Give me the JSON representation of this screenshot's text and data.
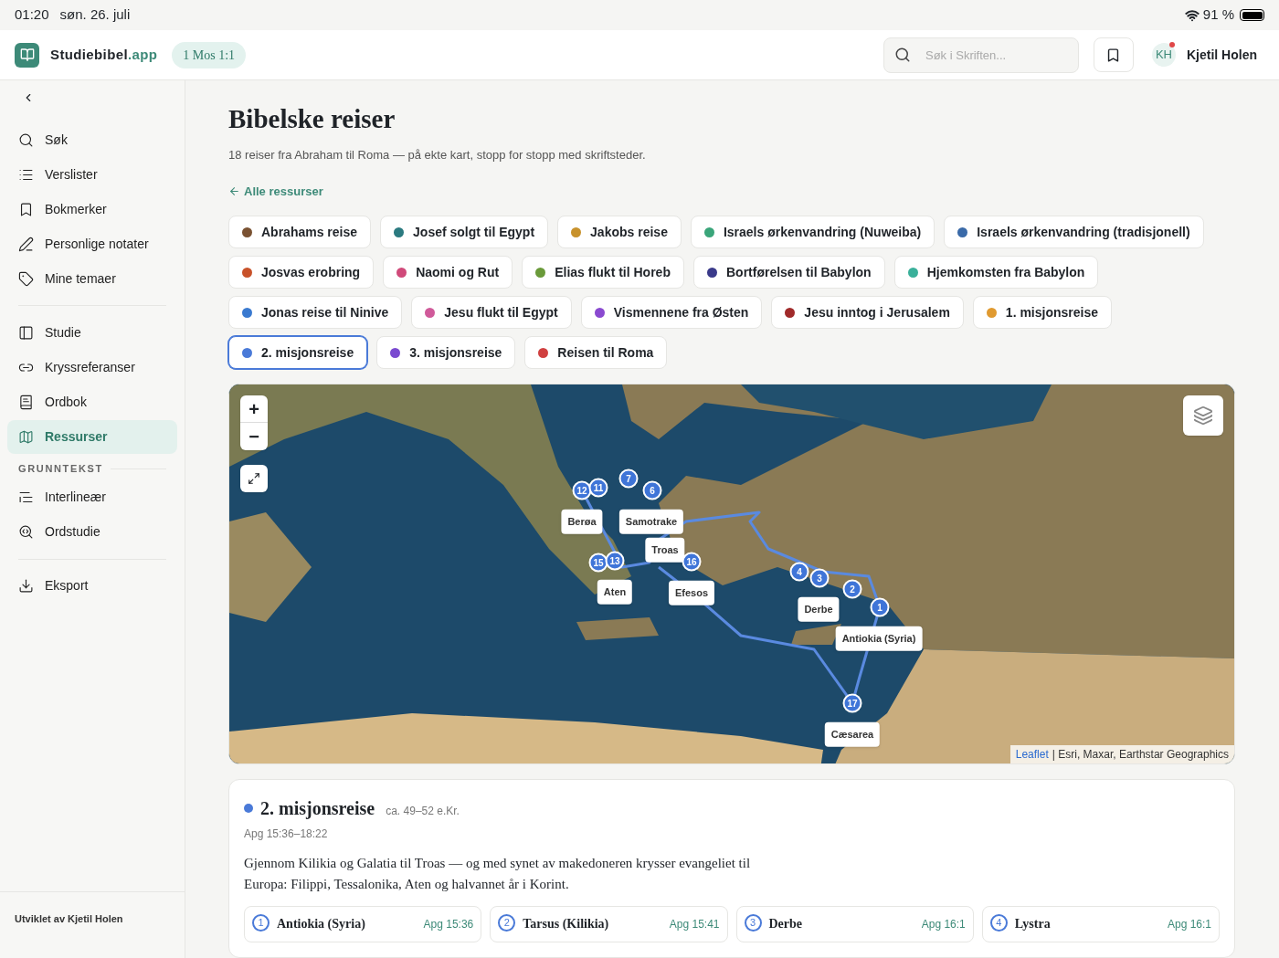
{
  "status_bar": {
    "time": "01:20",
    "date": "søn. 26. juli",
    "battery": "91 %"
  },
  "header": {
    "brand": "Studiebibel",
    "brand_suffix": ".app",
    "reference": "1 Mos 1:1",
    "search": {
      "placeholder": "Søk i Skriften..."
    },
    "user": {
      "initials": "KH",
      "name": "Kjetil Holen",
      "notification": true
    }
  },
  "sidebar": {
    "groups": [
      {
        "items": [
          {
            "label": "Søk",
            "selected": false
          },
          {
            "label": "Verslister",
            "selected": false
          },
          {
            "label": "Bokmerker",
            "selected": false
          },
          {
            "label": "Personlige notater",
            "selected": false
          },
          {
            "label": "Mine temaer",
            "selected": false
          }
        ]
      },
      {
        "items": [
          {
            "label": "Studie",
            "selected": false
          },
          {
            "label": "Kryssreferanser",
            "selected": false
          },
          {
            "label": "Ordbok",
            "selected": false
          },
          {
            "label": "Ressurser",
            "selected": true
          }
        ]
      },
      {
        "heading": "GRUNNTEKST",
        "items": [
          {
            "label": "Interlineær",
            "selected": false
          },
          {
            "label": "Ordstudie",
            "selected": false
          }
        ]
      },
      {
        "items": [
          {
            "label": "Eksport",
            "selected": false
          }
        ]
      }
    ],
    "footer": "Utviklet av Kjetil Holen"
  },
  "page": {
    "title": "Bibelske reiser",
    "subtitle": "18 reiser fra Abraham til Roma — på ekte kart, stopp for stopp med skriftsteder.",
    "back_link": "Alle ressurser"
  },
  "journeys": [
    {
      "label": "Abrahams reise",
      "color": "#7a5232",
      "selected": false
    },
    {
      "label": "Josef solgt til Egypt",
      "color": "#2b7a80",
      "selected": false
    },
    {
      "label": "Jakobs reise",
      "color": "#c8922c",
      "selected": false
    },
    {
      "label": "Israels ørkenvandring (Nuweiba)",
      "color": "#3aa57a",
      "selected": false
    },
    {
      "label": "Israels ørkenvandring (tradisjonell)",
      "color": "#3a6aa8",
      "selected": false
    },
    {
      "label": "Josvas erobring",
      "color": "#c8522a",
      "selected": false
    },
    {
      "label": "Naomi og Rut",
      "color": "#d04a7a",
      "selected": false
    },
    {
      "label": "Elias flukt til Horeb",
      "color": "#6a9a3a",
      "selected": false
    },
    {
      "label": "Bortførelsen til Babylon",
      "color": "#3a3a8a",
      "selected": false
    },
    {
      "label": "Hjemkomsten fra Babylon",
      "color": "#3ab09a",
      "selected": false
    },
    {
      "label": "Jonas reise til Ninive",
      "color": "#3a7ad0",
      "selected": false
    },
    {
      "label": "Jesu flukt til Egypt",
      "color": "#d05a9a",
      "selected": false
    },
    {
      "label": "Vismennene fra Østen",
      "color": "#8a4ad0",
      "selected": false
    },
    {
      "label": "Jesu inntog i Jerusalem",
      "color": "#a02a2a",
      "selected": false
    },
    {
      "label": "1. misjonsreise",
      "color": "#e09a30",
      "selected": false
    },
    {
      "label": "2. misjonsreise",
      "color": "#4a7ad8",
      "selected": true
    },
    {
      "label": "3. misjonsreise",
      "color": "#7a4ad0",
      "selected": false
    },
    {
      "label": "Reisen til Roma",
      "color": "#d04040",
      "selected": false
    }
  ],
  "map": {
    "markers": [
      "12",
      "11",
      "7",
      "6",
      "15",
      "13",
      "16",
      "4",
      "3",
      "2",
      "1",
      "17"
    ],
    "places": [
      "Berøa",
      "Samotrake",
      "Troas",
      "Aten",
      "Efesos",
      "Derbe",
      "Antiokia (Syria)",
      "Cæsarea"
    ],
    "zoom_in": "+",
    "zoom_out": "−",
    "attribution_link": "Leaflet",
    "attribution": "| Esri, Maxar, Earthstar Geographics"
  },
  "detail": {
    "title": "2. misjonsreise",
    "color": "#4a7ad8",
    "period": "ca. 49–52 e.Kr.",
    "reference": "Apg 15:36–18:22",
    "description": "Gjennom Kilikia og Galatia til Troas — og med synet av makedoneren krysser evangeliet til Europa: Filippi, Tessalonika, Aten og halvannet år i Korint.",
    "stops": [
      {
        "number": "1",
        "name": "Antiokia (Syria)",
        "reference": "Apg 15:36"
      },
      {
        "number": "2",
        "name": "Tarsus (Kilikia)",
        "reference": "Apg 15:41"
      },
      {
        "number": "3",
        "name": "Derbe",
        "reference": "Apg 16:1"
      },
      {
        "number": "4",
        "name": "Lystra",
        "reference": "Apg 16:1"
      }
    ]
  }
}
